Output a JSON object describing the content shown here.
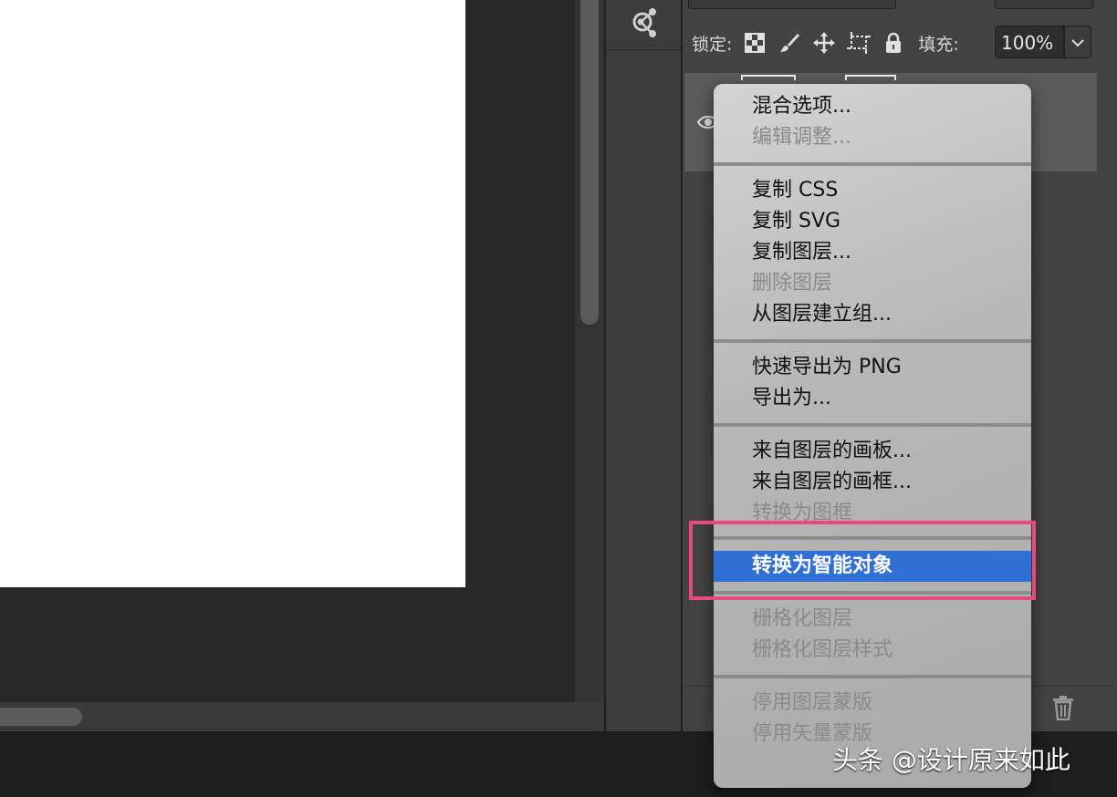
{
  "lock_row": {
    "label": "锁定:",
    "icons": [
      "checkerboard-icon",
      "brush-icon",
      "move-icon",
      "crop-icon",
      "padlock-icon"
    ],
    "fill_label": "填充:",
    "fill_value": "100%"
  },
  "context_menu": {
    "group1": [
      "混合选项...",
      "编辑调整..."
    ],
    "group2": [
      "复制 CSS",
      "复制 SVG",
      "复制图层...",
      "删除图层",
      "从图层建立组..."
    ],
    "group3": [
      "快速导出为 PNG",
      "导出为..."
    ],
    "group4": [
      "来自图层的画板...",
      "来自图层的画框...",
      "转换为图框"
    ],
    "highlighted": "转换为智能对象",
    "group5": [
      "栅格化图层",
      "栅格化图层样式"
    ],
    "group6": [
      "停用图层蒙版",
      "停用矢量蒙版"
    ]
  },
  "watermark": "头条 @设计原来如此",
  "colors": {
    "highlight": "#2f6fd6",
    "annotation_box": "#e84a7f"
  }
}
